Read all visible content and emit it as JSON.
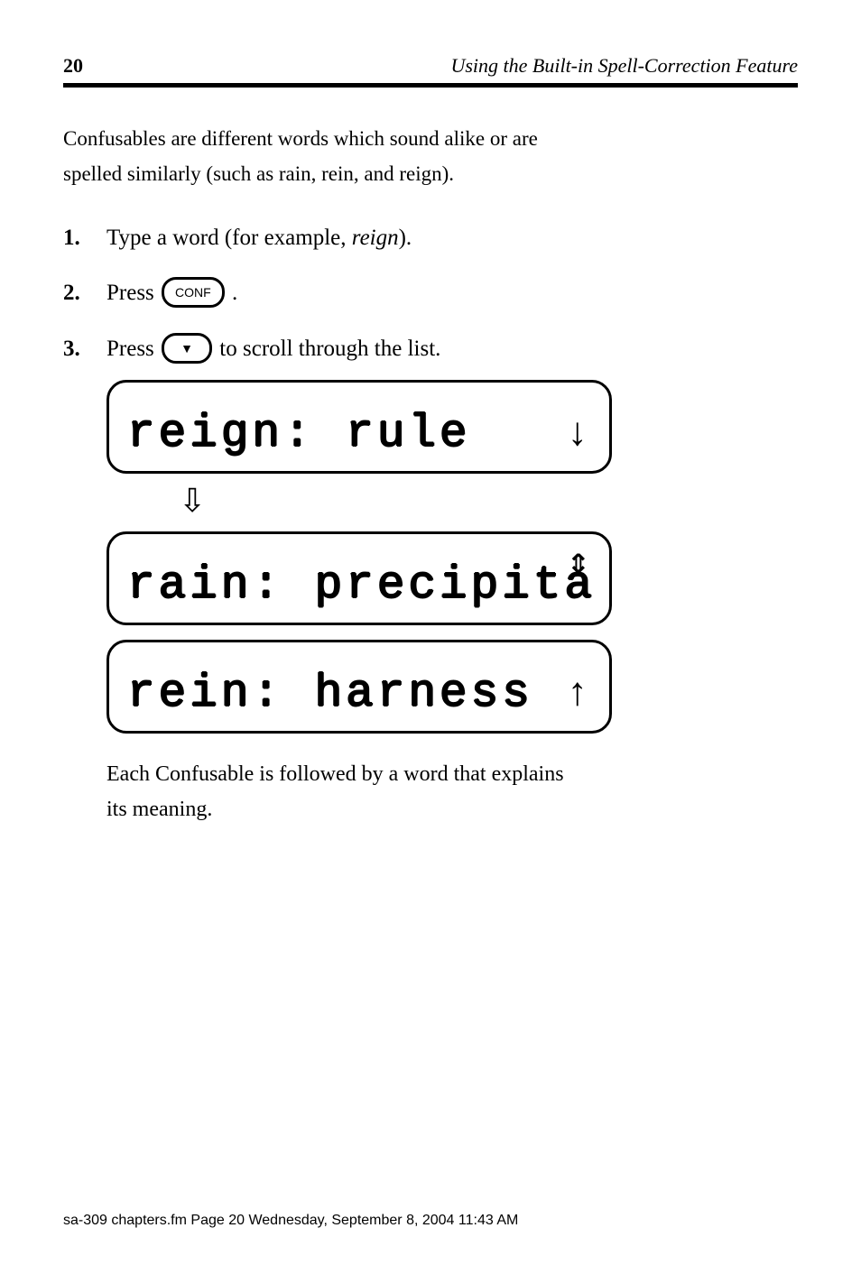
{
  "header": {
    "page_number": "20",
    "title": "Using the Built-in Spell-Correction Feature"
  },
  "intro": {
    "line1": "Confusables are different words which sound alike or are",
    "line2": "spelled similarly (such as rain, rein, and reign)."
  },
  "steps": {
    "s1": {
      "num": "1.",
      "before": "Type a word (for example, ",
      "word": "reign",
      "after": ")."
    },
    "s2": {
      "num": "2.",
      "before": "Press ",
      "after": " ."
    },
    "s3": {
      "num": "3.",
      "before": "Press ",
      "after": " to scroll through the list."
    }
  },
  "lcd": {
    "row1": "reign: rule",
    "row2": "rain: precipita",
    "row3": "rein: harness"
  },
  "arrows": {
    "down": "↓",
    "up": "↑",
    "flow": "⇩",
    "combo": "⇕"
  },
  "tail": {
    "line1": "Each Confusable is followed by a word that explains",
    "line2": "its meaning."
  },
  "footnote": "sa-309 chapters.fm  Page 20  Wednesday, September 8, 2004  11:43 AM"
}
